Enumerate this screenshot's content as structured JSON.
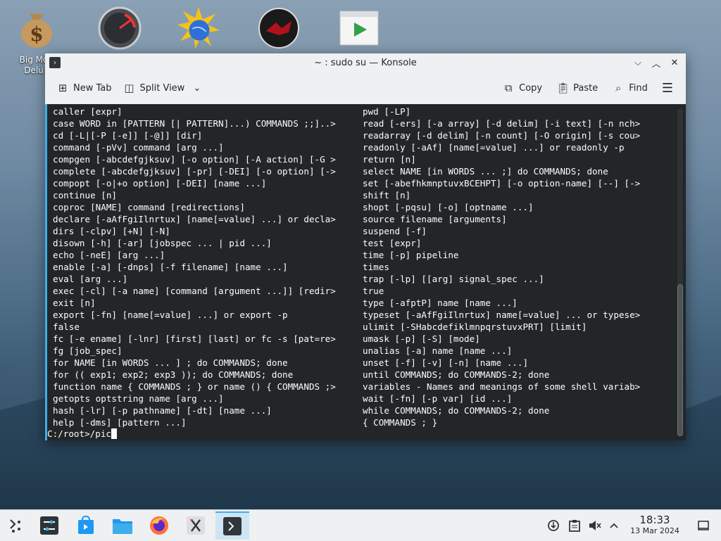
{
  "desktop": {
    "icons": [
      {
        "name": "big-money-icon",
        "label": "Big Mo\nDelu"
      },
      {
        "name": "speedometer-icon"
      },
      {
        "name": "sun-globe-icon"
      },
      {
        "name": "red-emblem-icon"
      },
      {
        "name": "media-player-icon"
      }
    ]
  },
  "window": {
    "title": "~ : sudo su — Konsole",
    "app_icon": "terminal-icon",
    "controls": {
      "minimize": "⌵",
      "maximize": "︿",
      "close": "✕"
    }
  },
  "toolbar": {
    "new_tab": "New Tab",
    "split_view": "Split View",
    "split_chevron": "⌄",
    "copy": "Copy",
    "paste": "Paste",
    "find": "Find",
    "menu_icon": "☰"
  },
  "terminal": {
    "left_column": [
      "caller [expr]",
      "case WORD in [PATTERN [| PATTERN]...) COMMANDS ;;]..>",
      "cd [-L|[-P [-e]] [-@]] [dir]",
      "command [-pVv] command [arg ...]",
      "compgen [-abcdefgjksuv] [-o option] [-A action] [-G >",
      "complete [-abcdefgjksuv] [-pr] [-DEI] [-o option] [->",
      "compopt [-o|+o option] [-DEI] [name ...]",
      "continue [n]",
      "coproc [NAME] command [redirections]",
      "declare [-aAfFgiIlnrtux] [name[=value] ...] or decla>",
      "dirs [-clpv] [+N] [-N]",
      "disown [-h] [-ar] [jobspec ... | pid ...]",
      "echo [-neE] [arg ...]",
      "enable [-a] [-dnps] [-f filename] [name ...]",
      "eval [arg ...]",
      "exec [-cl] [-a name] [command [argument ...]] [redir>",
      "exit [n]",
      "export [-fn] [name[=value] ...] or export -p",
      "false",
      "fc [-e ename] [-lnr] [first] [last] or fc -s [pat=re>",
      "fg [job_spec]",
      "for NAME [in WORDS ... ] ; do COMMANDS; done",
      "for (( exp1; exp2; exp3 )); do COMMANDS; done",
      "function name { COMMANDS ; } or name () { COMMANDS ;>",
      "getopts optstring name [arg ...]",
      "hash [-lr] [-p pathname] [-dt] [name ...]",
      "help [-dms] [pattern ...]"
    ],
    "right_column": [
      "pwd [-LP]",
      "read [-ers] [-a array] [-d delim] [-i text] [-n nch>",
      "readarray [-d delim] [-n count] [-O origin] [-s cou>",
      "readonly [-aAf] [name[=value] ...] or readonly -p",
      "return [n]",
      "select NAME [in WORDS ... ;] do COMMANDS; done",
      "set [-abefhkmnptuvxBCEHPT] [-o option-name] [--] [->",
      "shift [n]",
      "shopt [-pqsu] [-o] [optname ...]",
      "source filename [arguments]",
      "suspend [-f]",
      "test [expr]",
      "time [-p] pipeline",
      "times",
      "trap [-lp] [[arg] signal_spec ...]",
      "true",
      "type [-afptP] name [name ...]",
      "typeset [-aAfFgiIlnrtux] name[=value] ... or typese>",
      "ulimit [-SHabcdefiklmnpqrstuvxPRT] [limit]",
      "umask [-p] [-S] [mode]",
      "unalias [-a] name [name ...]",
      "unset [-f] [-v] [-n] [name ...]",
      "until COMMANDS; do COMMANDS-2; done",
      "variables - Names and meanings of some shell variab>",
      "wait [-fn] [-p var] [id ...]",
      "while COMMANDS; do COMMANDS-2; done",
      "{ COMMANDS ; }"
    ],
    "prompt": "C:/root>/pic",
    "scroll_position": 0.54
  },
  "taskbar": {
    "launcher": "application-launcher-icon",
    "tasks": [
      "system-settings-icon",
      "discover-store-icon",
      "file-manager-icon",
      "firefox-icon",
      "text-editor-icon",
      "konsole-icon"
    ],
    "active_task": "konsole-icon",
    "tray": [
      "network-icon",
      "clipboard-icon",
      "volume-muted-icon",
      "tray-expand-icon"
    ],
    "clock_time": "18:33",
    "clock_date": "13 Mar 2024",
    "show_desktop": "show-desktop-icon"
  }
}
